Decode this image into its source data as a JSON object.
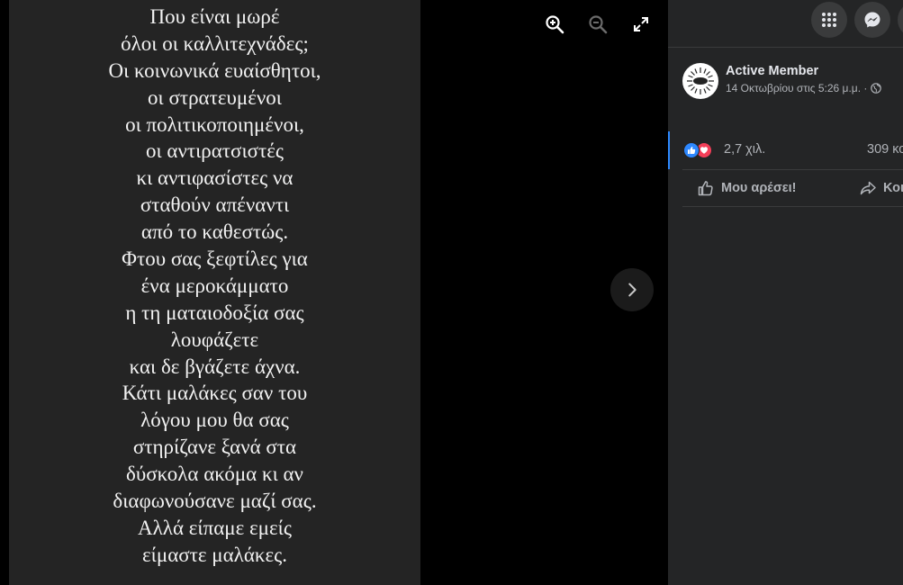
{
  "poem": {
    "lines": [
      "Που είναι μωρέ",
      "όλοι οι καλλιτεχνάδες;",
      "Οι κοινωνικά ευαίσθητοι,",
      "οι στρατευμένοι",
      "οι πολιτικοποιημένοι,",
      "οι αντιρατσιστές",
      "κι αντιφασίστες να",
      "σταθούν απέναντι",
      "από το καθεστώς.",
      "Φτου σας ξεφτίλες για",
      "ένα μεροκάμματο",
      "η τη ματαιοδοξία σας",
      "λουφάζετε",
      "και δε βγάζετε άχνα.",
      "Κάτι μαλάκες σαν του",
      "λόγου μου θα σας",
      "στηρίζανε ξανά στα",
      "δύσκολα ακόμα κι αν",
      "διαφωνούσανε μαζί σας.",
      "Αλλά είπαμε εμείς",
      "είμαστε μαλάκες."
    ]
  },
  "viewer": {
    "icons": {
      "zoom_in": "zoom-in-icon",
      "zoom_out": "zoom-out-icon",
      "fullscreen": "fullscreen-icon",
      "next": "chevron-right-icon"
    }
  },
  "topbar": {
    "icons": [
      "grid-menu-icon",
      "messenger-icon",
      "notifications-icon"
    ]
  },
  "post": {
    "author": "Active Member",
    "timestamp": "14 Οκτωβρίου στις 5:26 μ.μ. ·",
    "reaction_count": "2,7 χιλ.",
    "comments_count": "309 κο",
    "like_label": "Μου αρέσει!",
    "share_label": "Κοι"
  },
  "colors": {
    "accent": "#2d88ff",
    "love": "#f33e58",
    "panel_bg": "#242526",
    "photo_bg": "#242424"
  }
}
